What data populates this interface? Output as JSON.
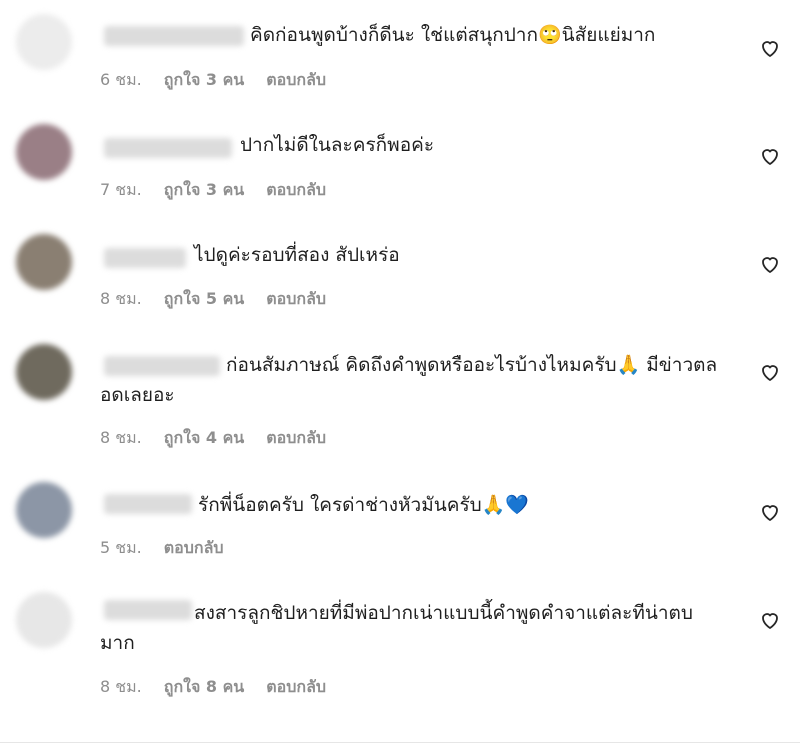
{
  "comments": [
    {
      "text": "คิดก่อนพูดบ้างก็ดีนะ ใช่แต่สนุกปาก🙄นิสัยแย่มาก",
      "time": "6 ชม.",
      "likes": "ถูกใจ 3 คน",
      "reply": "ตอบกลับ",
      "avatar_color": "#ececec"
    },
    {
      "text": "ปากไม่ดีในละครก็พอค่ะ",
      "time": "7 ชม.",
      "likes": "ถูกใจ 3 คน",
      "reply": "ตอบกลับ",
      "avatar_color": "#9a7f86"
    },
    {
      "text": "ไปดูค่ะรอบที่สอง สัปเหร่อ",
      "time": "8 ชม.",
      "likes": "ถูกใจ 5 คน",
      "reply": "ตอบกลับ",
      "avatar_color": "#8a7f72"
    },
    {
      "text": "ก่อนสัมภาษณ์ คิดถึงคำพูดหรืออะไรบ้างไหมครับ🙏 มีข่าวตลอดเลยอะ",
      "time": "8 ชม.",
      "likes": "ถูกใจ 4 คน",
      "reply": "ตอบกลับ",
      "avatar_color": "#6f6a5e"
    },
    {
      "text": "รักพี่น็อตครับ ใครด่าช่างหัวมันครับ🙏💙",
      "time": "5 ชม.",
      "likes": "",
      "reply": "ตอบกลับ",
      "avatar_color": "#8c96a6"
    },
    {
      "text": "สงสารลูกชิปหายที่มีพ่อปากเน่าแบบนี้คำพูดคำจาแต่ละทีน่าตบมาก",
      "time": "8 ชม.",
      "likes": "ถูกใจ 8 คน",
      "reply": "ตอบกลับ",
      "avatar_color": "#e7e7e7"
    }
  ]
}
